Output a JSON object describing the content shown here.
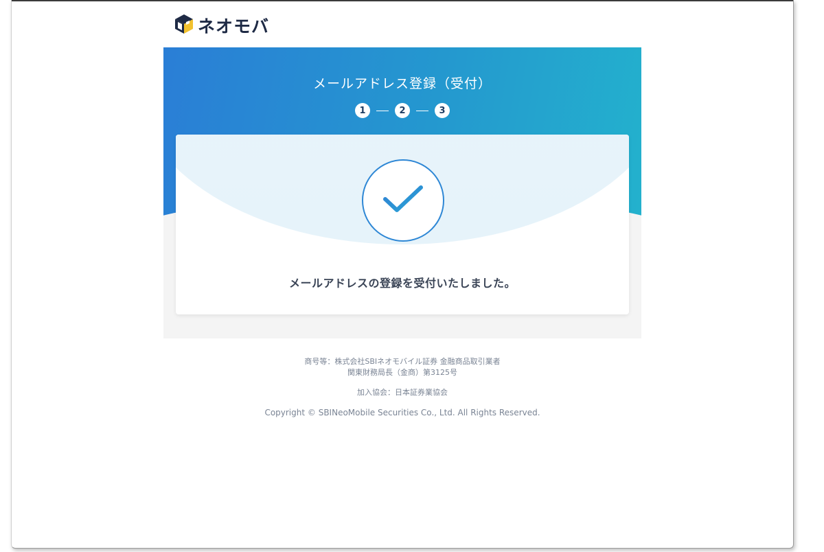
{
  "header": {
    "logo_text": "ネオモバ",
    "logo_icon": "neomoba-cube-logo"
  },
  "hero": {
    "title": "メールアドレス登録（受付）",
    "steps": [
      "1",
      "2",
      "3"
    ],
    "step_separator": "—"
  },
  "card": {
    "icon": "check-icon",
    "message": "メールアドレスの登録を受付いたしました。"
  },
  "footer": {
    "company_line": "商号等：株式会社SBIネオモバイル証券 金融商品取引業者",
    "registration_line": "関東財務局長（金商）第3125号",
    "association_line": "加入協会：日本証券業協会",
    "copyright": "Copyright © SBINeoMobile Securities Co., Ltd. All Rights Reserved."
  },
  "colors": {
    "gradient_start": "#2a7ed6",
    "gradient_end": "#23b2cd",
    "check_blue": "#2e87d5",
    "text_dark": "#3a4456",
    "footer_text": "#7a8494",
    "logo_text": "#1e2a45"
  }
}
